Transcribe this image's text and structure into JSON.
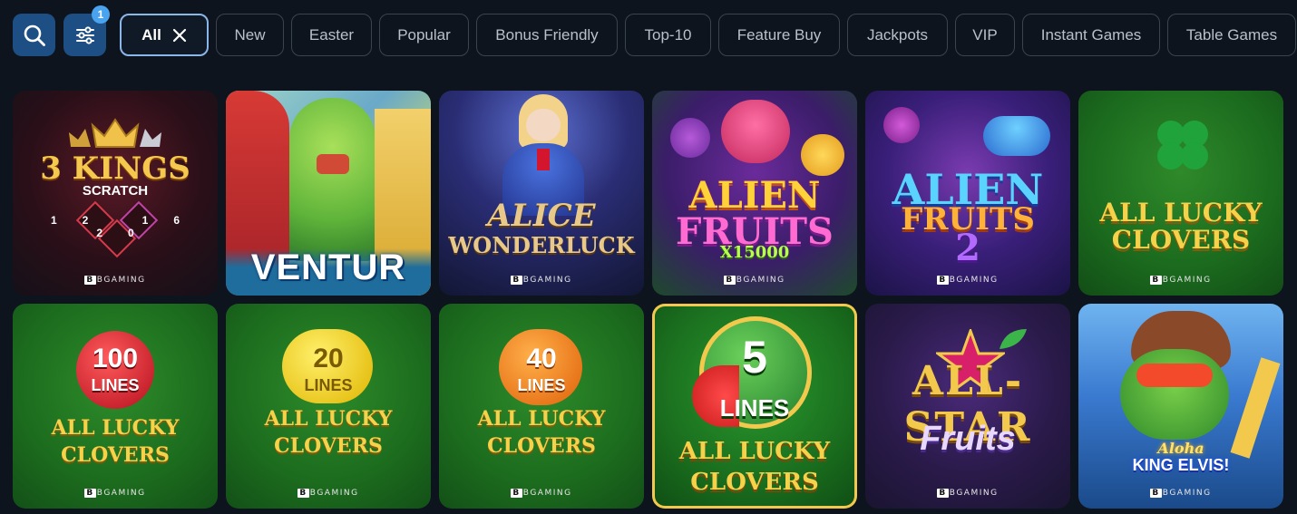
{
  "filters": {
    "count_badge": "1",
    "chips": [
      {
        "label": "All",
        "active": true
      },
      {
        "label": "New"
      },
      {
        "label": "Easter"
      },
      {
        "label": "Popular"
      },
      {
        "label": "Bonus Friendly"
      },
      {
        "label": "Top-10"
      },
      {
        "label": "Feature Buy"
      },
      {
        "label": "Jackpots"
      },
      {
        "label": "VIP"
      },
      {
        "label": "Instant Games"
      },
      {
        "label": "Table Games"
      }
    ]
  },
  "games": [
    {
      "line1": "3 KINGS",
      "line2": "SCRATCH",
      "line3": "12 16 20",
      "provider": "BGAMING"
    },
    {
      "line1": "",
      "line2": "",
      "line3": "VENTUR",
      "provider": ""
    },
    {
      "line1": "ALICE",
      "line2": "WONDERLUCK",
      "line3": "",
      "provider": "BGAMING"
    },
    {
      "line1": "ALIEN",
      "line2": "FRUITS",
      "line3": "X15000",
      "provider": "BGAMING"
    },
    {
      "line1": "ALIEN",
      "line2": "FRUITS",
      "line3": "2",
      "provider": "BGAMING"
    },
    {
      "line1": "ALL LUCKY",
      "line2": "CLOVERS",
      "line3": "",
      "provider": "BGAMING"
    },
    {
      "line1": "100",
      "line2": "LINES",
      "line3": "ALL LUCKY CLOVERS",
      "provider": "BGAMING"
    },
    {
      "line1": "20",
      "line2": "LINES",
      "line3": "ALL LUCKY CLOVERS",
      "provider": "BGAMING"
    },
    {
      "line1": "40",
      "line2": "LINES",
      "line3": "ALL LUCKY CLOVERS",
      "provider": "BGAMING"
    },
    {
      "line1": "5",
      "line2": "LINES",
      "line3": "ALL LUCKY CLOVERS",
      "provider": ""
    },
    {
      "line1": "ALL-STAR",
      "line2": "Fruits",
      "line3": "",
      "provider": "BGAMING"
    },
    {
      "line1": "Aloha",
      "line2": "KING ELVIS!",
      "line3": "",
      "provider": "BGAMING"
    }
  ],
  "colors": {
    "page_bg": "#0d141d",
    "accent": "#1d4f84",
    "badge": "#4aa3ee",
    "chip_border": "#3b434d",
    "chip_active_border": "#8bb6ea"
  },
  "icons": {
    "search": "search-icon",
    "filter": "sliders-icon",
    "clear": "close-icon"
  }
}
